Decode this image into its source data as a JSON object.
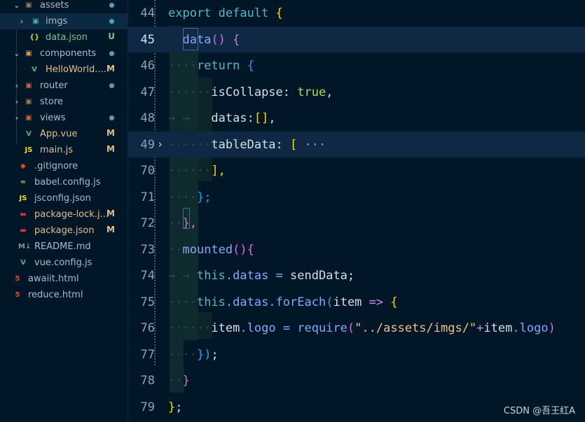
{
  "explorer": {
    "items": [
      {
        "name": "assets",
        "badge": "",
        "dot": "#4aa3c1",
        "kind": "folder-open",
        "icon": "folder-icon",
        "glyph": "▣",
        "iconColor": "#9e7b5a",
        "chev": "⌄"
      },
      {
        "name": "imgs",
        "badge": "",
        "dot": "#4aa3c1",
        "kind": "folder",
        "icon": "images-folder-icon",
        "glyph": "▣",
        "iconColor": "#45b59a",
        "chev": "›"
      },
      {
        "name": "data.json",
        "badge": "U",
        "badgeColor": "#73c991",
        "kind": "file",
        "icon": "json-file-icon",
        "glyph": "{}",
        "iconColor": "#cbcb41"
      },
      {
        "name": "components",
        "badge": "",
        "dot": "#4aa3c1",
        "kind": "folder-open",
        "icon": "components-folder-icon",
        "glyph": "▣",
        "iconColor": "#d4a04a",
        "chev": "⌄"
      },
      {
        "name": "HelloWorld....",
        "badge": "M",
        "badgeColor": "#e2c08d",
        "kind": "file",
        "icon": "vue-file-icon",
        "glyph": "V",
        "iconColor": "#41b883"
      },
      {
        "name": "router",
        "badge": "",
        "dot": "#4aa3c1",
        "kind": "folder",
        "icon": "router-folder-icon",
        "glyph": "▣",
        "iconColor": "#c46a4a",
        "chev": "›"
      },
      {
        "name": "store",
        "badge": "",
        "kind": "folder",
        "icon": "store-folder-icon",
        "glyph": "▣",
        "iconColor": "#9e7b5a",
        "chev": "›"
      },
      {
        "name": "views",
        "badge": "",
        "dot": "#4aa3c1",
        "kind": "folder",
        "icon": "views-folder-icon",
        "glyph": "▣",
        "iconColor": "#d0643c",
        "chev": "›"
      },
      {
        "name": "App.vue",
        "badge": "M",
        "badgeColor": "#e2c08d",
        "kind": "file",
        "icon": "vue-file-icon",
        "glyph": "V",
        "iconColor": "#41b883"
      },
      {
        "name": "main.js",
        "badge": "M",
        "badgeColor": "#e2c08d",
        "kind": "file",
        "icon": "js-file-icon",
        "glyph": "JS",
        "iconColor": "#f1dd35"
      },
      {
        "name": ".gitignore",
        "badge": "",
        "kind": "file",
        "icon": "git-file-icon",
        "glyph": "◆",
        "iconColor": "#e24e1b"
      },
      {
        "name": "babel.config.js",
        "badge": "",
        "kind": "file",
        "icon": "babel-file-icon",
        "glyph": "≈",
        "iconColor": "#d6b95a"
      },
      {
        "name": "jsconfig.json",
        "badge": "",
        "kind": "file",
        "icon": "jsconfig-file-icon",
        "glyph": "JS",
        "iconColor": "#f1dd35"
      },
      {
        "name": "package-lock.j...",
        "badge": "M",
        "badgeColor": "#e2c08d",
        "kind": "file",
        "icon": "npm-file-icon",
        "glyph": "▬",
        "iconColor": "#cb3837"
      },
      {
        "name": "package.json",
        "badge": "M",
        "badgeColor": "#e2c08d",
        "kind": "file",
        "icon": "npm-file-icon",
        "glyph": "▬",
        "iconColor": "#cb3837"
      },
      {
        "name": "README.md",
        "badge": "",
        "kind": "file",
        "icon": "markdown-file-icon",
        "glyph": "M↓",
        "iconColor": "#8a8f98"
      },
      {
        "name": "vue.config.js",
        "badge": "",
        "kind": "file",
        "icon": "vue-config-file-icon",
        "glyph": "V",
        "iconColor": "#41b883"
      },
      {
        "name": "awaiit.html",
        "badge": "",
        "kind": "file",
        "icon": "html-file-icon",
        "glyph": "5",
        "iconColor": "#e44d26"
      },
      {
        "name": "reduce.html",
        "badge": "",
        "kind": "file",
        "icon": "html-file-icon",
        "glyph": "5",
        "iconColor": "#e44d26"
      }
    ]
  },
  "editor": {
    "lines": [
      {
        "n": "44",
        "tokens": [
          {
            "t": "export",
            "c": "#56b6c2"
          },
          {
            "t": " default ",
            "c": "#56b6c2"
          },
          {
            "t": "{",
            "c": "#ffd700"
          }
        ]
      },
      {
        "n": "45",
        "current": true,
        "tokens": [
          {
            "t": "  ",
            "c": "ws"
          },
          {
            "t": "data",
            "c": "#82aaff"
          },
          {
            "t": "() ",
            "c": "#da70d6"
          },
          {
            "t": "{",
            "c": "#da70d6"
          }
        ]
      },
      {
        "n": "46",
        "tokens": [
          {
            "t": "····",
            "c": "ws"
          },
          {
            "t": "return",
            "c": "#56b6c2"
          },
          {
            "t": " {",
            "c": "#179fff"
          }
        ]
      },
      {
        "n": "47",
        "tokens": [
          {
            "t": "······",
            "c": "ws"
          },
          {
            "t": "isCollapse",
            "c": "#d6deeb"
          },
          {
            "t": ": ",
            "c": "#d6deeb"
          },
          {
            "t": "true",
            "c": "#addb67"
          },
          {
            "t": ",",
            "c": "#d6deeb"
          }
        ]
      },
      {
        "n": "48",
        "tokens": [
          {
            "t": "→ → ",
            "c": "ws"
          },
          {
            "t": "  datas",
            "c": "#d6deeb"
          },
          {
            "t": ":",
            "c": "#d6deeb"
          },
          {
            "t": "[]",
            "c": "#ffd700"
          },
          {
            "t": ",",
            "c": "#d6deeb"
          }
        ]
      },
      {
        "n": "49",
        "fold": "›",
        "tokens": [
          {
            "t": "······",
            "c": "ws"
          },
          {
            "t": "tableData",
            "c": "#d6deeb"
          },
          {
            "t": ": ",
            "c": "#d6deeb"
          },
          {
            "t": "[",
            "c": "#ffd700"
          },
          {
            "t": " ···",
            "c": "#8aa5b7"
          }
        ]
      },
      {
        "n": "70",
        "tokens": [
          {
            "t": "······",
            "c": "ws"
          },
          {
            "t": "],",
            "c": "#ffd700"
          }
        ]
      },
      {
        "n": "71",
        "tokens": [
          {
            "t": "····",
            "c": "ws"
          },
          {
            "t": "};",
            "c": "#179fff"
          }
        ]
      },
      {
        "n": "72",
        "tokens": [
          {
            "t": "··",
            "c": "ws"
          },
          {
            "t": "},",
            "c": "#da70d6"
          }
        ]
      },
      {
        "n": "73",
        "tokens": [
          {
            "t": "··",
            "c": "ws"
          },
          {
            "t": "mounted",
            "c": "#82aaff"
          },
          {
            "t": "()",
            "c": "#da70d6"
          },
          {
            "t": "{",
            "c": "#da70d6"
          }
        ]
      },
      {
        "n": "74",
        "tokens": [
          {
            "t": "→ → ",
            "c": "ws"
          },
          {
            "t": "this",
            "c": "#56b6c2"
          },
          {
            "t": ".datas = ",
            "c": "#82aaff"
          },
          {
            "t": "sendData",
            "c": "#d6deeb"
          },
          {
            "t": ";",
            "c": "#d6deeb"
          }
        ]
      },
      {
        "n": "75",
        "tokens": [
          {
            "t": "····",
            "c": "ws"
          },
          {
            "t": "this",
            "c": "#56b6c2"
          },
          {
            "t": ".datas.",
            "c": "#82aaff"
          },
          {
            "t": "forEach",
            "c": "#82aaff"
          },
          {
            "t": "(",
            "c": "#179fff"
          },
          {
            "t": "item",
            "c": "#d6deeb"
          },
          {
            "t": " => ",
            "c": "#c792ea"
          },
          {
            "t": "{",
            "c": "#ffd700"
          }
        ]
      },
      {
        "n": "76",
        "tokens": [
          {
            "t": "······",
            "c": "ws"
          },
          {
            "t": "item",
            "c": "#d6deeb"
          },
          {
            "t": ".logo = ",
            "c": "#82aaff"
          },
          {
            "t": "require",
            "c": "#82aaff"
          },
          {
            "t": "(",
            "c": "#da70d6"
          },
          {
            "t": "\"../assets/imgs/\"",
            "c": "#ecc48d"
          },
          {
            "t": "+",
            "c": "#c792ea"
          },
          {
            "t": "item",
            "c": "#d6deeb"
          },
          {
            "t": ".logo",
            "c": "#82aaff"
          },
          {
            "t": ")",
            "c": "#da70d6"
          }
        ]
      },
      {
        "n": "77",
        "tokens": [
          {
            "t": "····",
            "c": "ws"
          },
          {
            "t": "})",
            "c": "#179fff"
          },
          {
            "t": ";",
            "c": "#d6deeb"
          }
        ]
      },
      {
        "n": "78",
        "tokens": [
          {
            "t": "··",
            "c": "ws"
          },
          {
            "t": "}",
            "c": "#da70d6"
          }
        ]
      },
      {
        "n": "79",
        "tokens": [
          {
            "t": "}",
            "c": "#ffd700"
          },
          {
            "t": ";",
            "c": "#d6deeb"
          }
        ]
      }
    ]
  },
  "watermark": "CSDN @吾王红A"
}
